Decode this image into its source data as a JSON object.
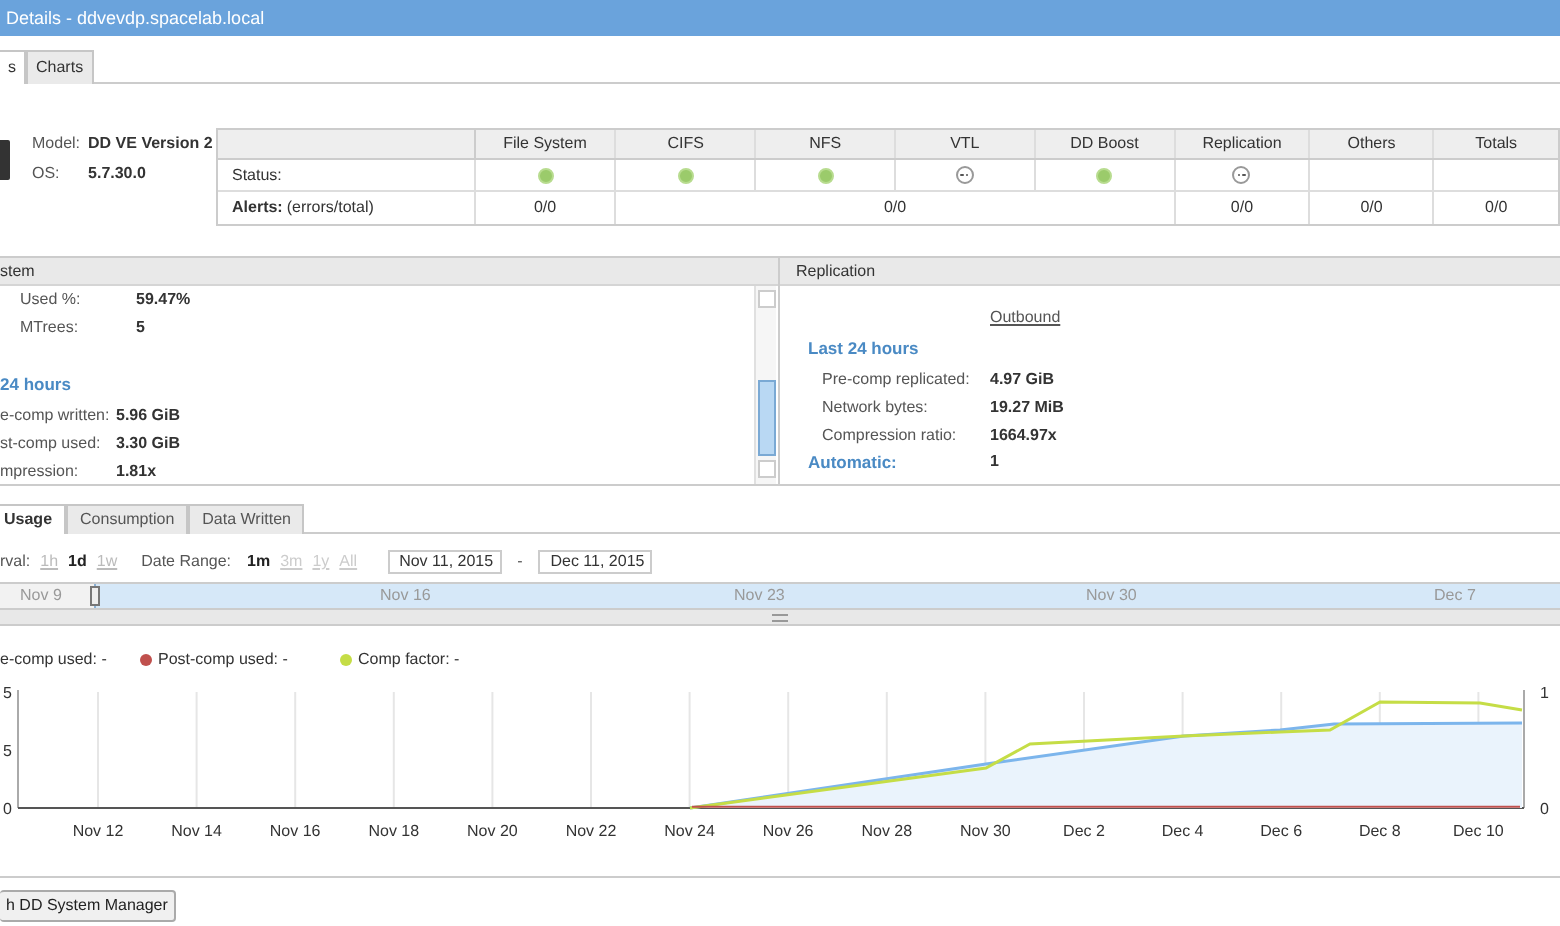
{
  "window": {
    "title": "Details - ddvevdp.spacelab.local"
  },
  "tabs": [
    {
      "label": "s",
      "selected": true
    },
    {
      "label": "Charts",
      "selected": false
    }
  ],
  "system": {
    "model_label": "Model:",
    "model": "DD VE Version 2",
    "os_label": "OS:",
    "os": "5.7.30.0"
  },
  "status_table": {
    "status_label": "Status:",
    "alerts_label": "Alerts:",
    "alerts_note": "(errors/total)",
    "columns": [
      {
        "label": "File System",
        "kind": "ok"
      },
      {
        "label": "CIFS",
        "kind": "ok"
      },
      {
        "label": "NFS",
        "kind": "ok"
      },
      {
        "label": "VTL",
        "kind": "disabled"
      },
      {
        "label": "DD Boost",
        "kind": "ok"
      },
      {
        "label": "Replication",
        "kind": "disabled"
      },
      {
        "label": "Others"
      },
      {
        "label": "Totals"
      }
    ],
    "alerts": [
      "0/0",
      "0/0",
      "0/0",
      "0/0",
      "0/0"
    ]
  },
  "file_system_panel": {
    "title": "stem",
    "rows": [
      {
        "label": "Used %:",
        "value": "59.47%"
      },
      {
        "label": "MTrees:",
        "value": "5"
      }
    ],
    "section": "24 hours",
    "section_rows": [
      {
        "label": "e-comp written:",
        "value": "5.96 GiB"
      },
      {
        "label": "st-comp used:",
        "value": "3.30 GiB"
      },
      {
        "label": "mpression:",
        "value": "1.81x"
      }
    ]
  },
  "replication_panel": {
    "title": "Replication",
    "column": "Outbound",
    "section": "Last 24 hours",
    "rows": [
      {
        "label": "Pre-comp replicated:",
        "value": "4.97 GiB"
      },
      {
        "label": "Network bytes:",
        "value": "19.27 MiB"
      },
      {
        "label": "Compression ratio:",
        "value": "1664.97x"
      }
    ],
    "automatic_label": "Automatic:",
    "automatic": "1"
  },
  "chart_tabs": [
    {
      "label": "Usage",
      "selected": true
    },
    {
      "label": "Consumption",
      "selected": false
    },
    {
      "label": "Data Written",
      "selected": false
    }
  ],
  "interval": {
    "label": "rval:",
    "options": [
      {
        "label": "1h",
        "selected": false
      },
      {
        "label": "1d",
        "selected": true
      },
      {
        "label": "1w",
        "selected": false
      }
    ]
  },
  "date_range": {
    "label": "Date Range:",
    "options": [
      {
        "label": "1m",
        "selected": true
      },
      {
        "label": "3m",
        "selected": false
      },
      {
        "label": "1y",
        "selected": false
      },
      {
        "label": "All",
        "selected": false
      }
    ],
    "from": "Nov 11, 2015",
    "separator": "-",
    "to": "Dec 11, 2015"
  },
  "navigator_labels": [
    "Nov 9",
    "Nov 16",
    "Nov 23",
    "Nov 30",
    "Dec 7"
  ],
  "legend": [
    {
      "label": "e-comp used: -"
    },
    {
      "label": "Post-comp used: -",
      "color": "#c0504d"
    },
    {
      "label": "Comp factor: -",
      "color": "#c5dd46"
    }
  ],
  "chart": {
    "left_ticks": [
      "5",
      "5",
      "0"
    ],
    "right_ticks": [
      "1",
      "0"
    ],
    "x_labels": [
      "Nov 12",
      "Nov 14",
      "Nov 16",
      "Nov 18",
      "Nov 20",
      "Nov 22",
      "Nov 24",
      "Nov 26",
      "Nov 28",
      "Nov 30",
      "Dec 2",
      "Dec 4",
      "Dec 6",
      "Dec 8",
      "Dec 10"
    ]
  },
  "button": "h DD System Manager"
}
